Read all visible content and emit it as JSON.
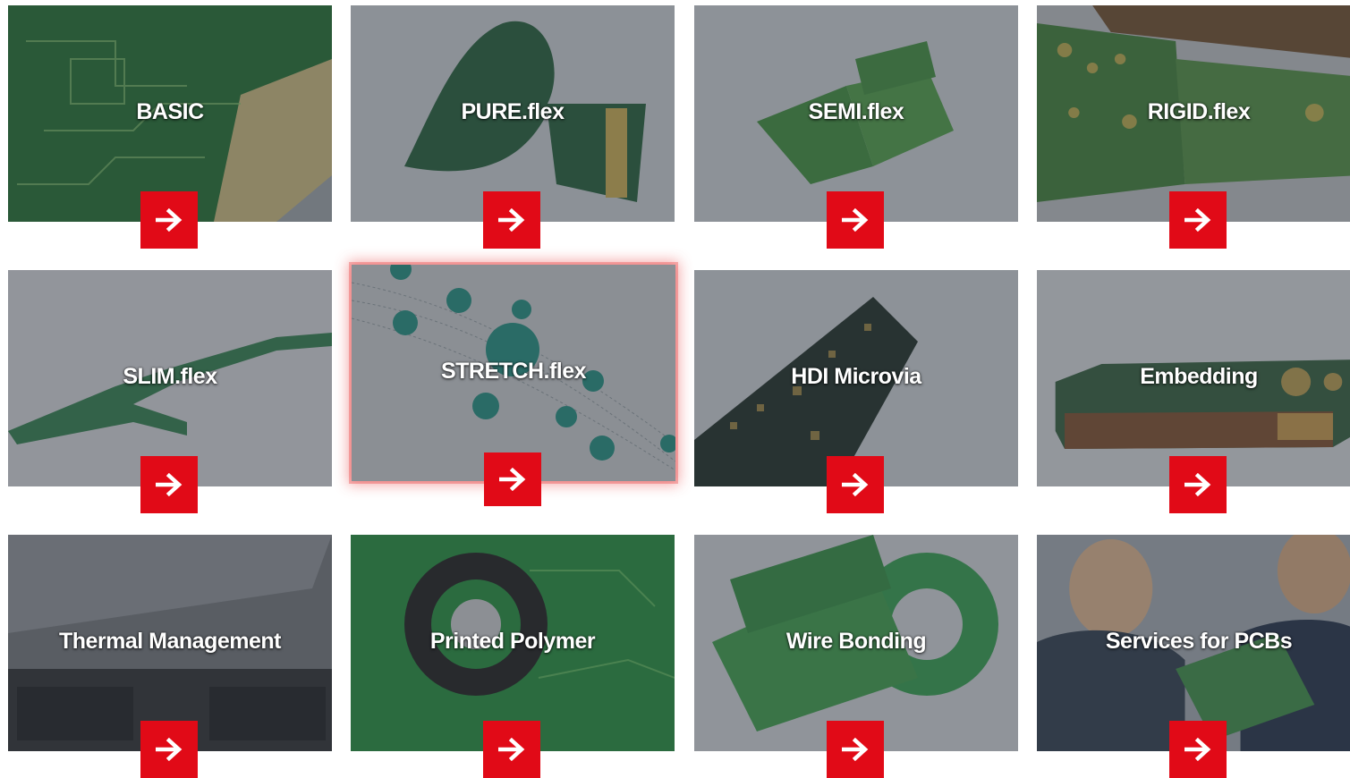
{
  "tiles": [
    {
      "label": "BASIC",
      "icon": "arrow-right-icon"
    },
    {
      "label": "PURE.flex",
      "icon": "arrow-right-icon"
    },
    {
      "label": "SEMI.flex",
      "icon": "arrow-right-icon"
    },
    {
      "label": "RIGID.flex",
      "icon": "arrow-right-icon"
    },
    {
      "label": "SLIM.flex",
      "icon": "arrow-right-icon"
    },
    {
      "label": "STRETCH.flex",
      "icon": "arrow-right-icon",
      "highlighted": true
    },
    {
      "label": "HDI Microvia",
      "icon": "arrow-right-icon"
    },
    {
      "label": "Embedding",
      "icon": "arrow-right-icon"
    },
    {
      "label": "Thermal Management",
      "icon": "arrow-right-icon"
    },
    {
      "label": "Printed Polymer",
      "icon": "arrow-right-icon"
    },
    {
      "label": "Wire Bonding",
      "icon": "arrow-right-icon"
    },
    {
      "label": "Services for PCBs",
      "icon": "arrow-right-icon"
    }
  ],
  "colors": {
    "accent": "#e10a17",
    "highlight": "#e73c3c",
    "overlay": "#3c4048"
  }
}
